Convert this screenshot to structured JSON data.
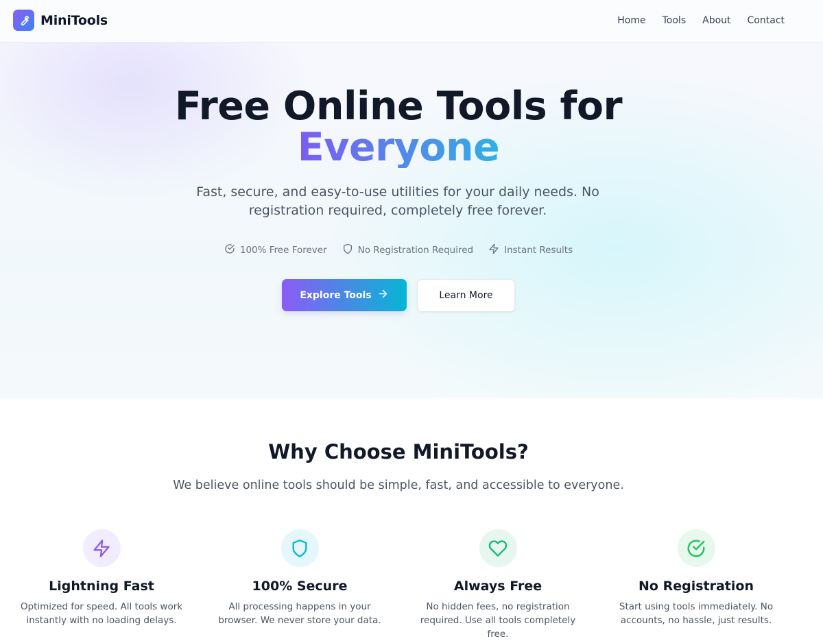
{
  "header": {
    "brand": "MiniTools",
    "nav": [
      "Home",
      "Tools",
      "About",
      "Contact"
    ]
  },
  "hero": {
    "title_line1": "Free Online Tools for",
    "title_line2": "Everyone",
    "subtitle": "Fast, secure, and easy-to-use utilities for your daily needs. No registration required, completely free forever.",
    "perks": [
      {
        "icon": "check-circle-icon",
        "label": "100% Free Forever"
      },
      {
        "icon": "shield-icon",
        "label": "No Registration Required"
      },
      {
        "icon": "lightning-icon",
        "label": "Instant Results"
      }
    ],
    "primary_button": "Explore Tools",
    "secondary_button": "Learn More"
  },
  "why": {
    "title": "Why Choose MiniTools?",
    "subtitle": "We believe online tools should be simple, fast, and accessible to everyone."
  },
  "features": [
    {
      "icon": "lightning-icon",
      "title": "Lightning Fast",
      "text": "Optimized for speed. All tools work instantly with no loading delays.",
      "color": "#8b5cf6",
      "bg": "#f1edfe"
    },
    {
      "icon": "shield-icon",
      "title": "100% Secure",
      "text": "All processing happens in your browser. We never store your data.",
      "color": "#06b6d4",
      "bg": "#e6f7fb"
    },
    {
      "icon": "heart-icon",
      "title": "Always Free",
      "text": "No hidden fees, no registration required. Use all tools completely free.",
      "color": "#10b981",
      "bg": "#e7f7f0"
    },
    {
      "icon": "check-circle-icon",
      "title": "No Registration",
      "text": "Start using tools immediately. No accounts, no hassle, just results.",
      "color": "#22c55e",
      "bg": "#e9f8ef"
    }
  ],
  "colors": {
    "accent_start": "#8b5cf6",
    "accent_end": "#06b6d4",
    "text_dark": "#111827"
  }
}
